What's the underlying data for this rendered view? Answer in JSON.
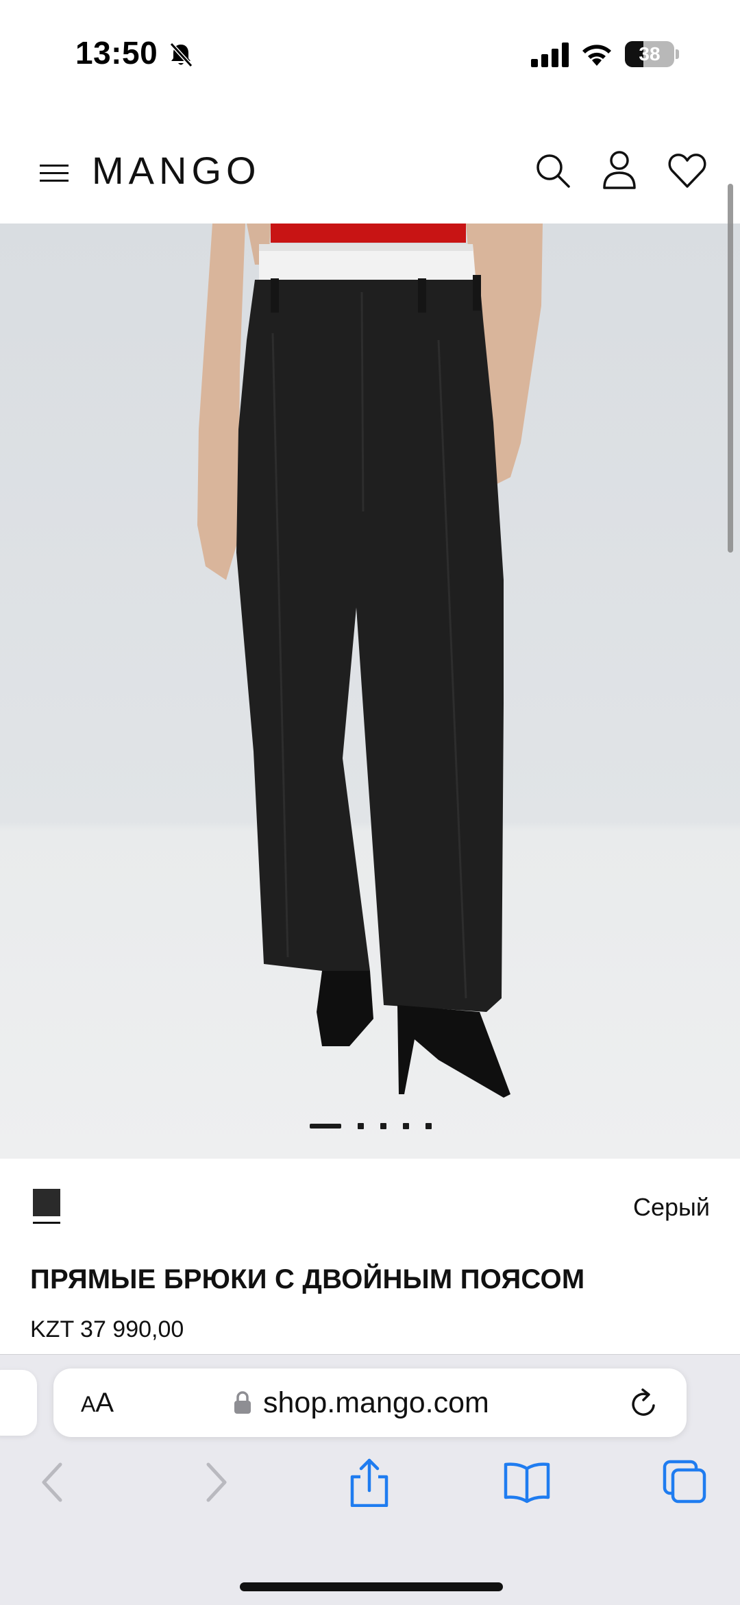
{
  "status_bar": {
    "time": "13:50",
    "battery_percent": "38",
    "battery_level": 0.38
  },
  "header": {
    "brand": "MANGO",
    "icons": [
      "menu-icon",
      "search-icon",
      "user-icon",
      "heart-icon"
    ]
  },
  "gallery": {
    "image_count": 5,
    "active_index": 0
  },
  "product": {
    "color_name": "Серый",
    "title": "ПРЯМЫЕ БРЮКИ С ДВОЙНЫМ ПОЯСОМ",
    "price": "KZT 37 990,00"
  },
  "browser": {
    "aa_small": "A",
    "aa_large": "A",
    "url": "shop.mango.com",
    "toolbar_icons": [
      "back-icon",
      "forward-icon",
      "share-icon",
      "bookmarks-icon",
      "tabs-icon"
    ]
  },
  "colors": {
    "accent_blue": "#1f7cf0",
    "disabled_gray": "#b9b9bf"
  }
}
